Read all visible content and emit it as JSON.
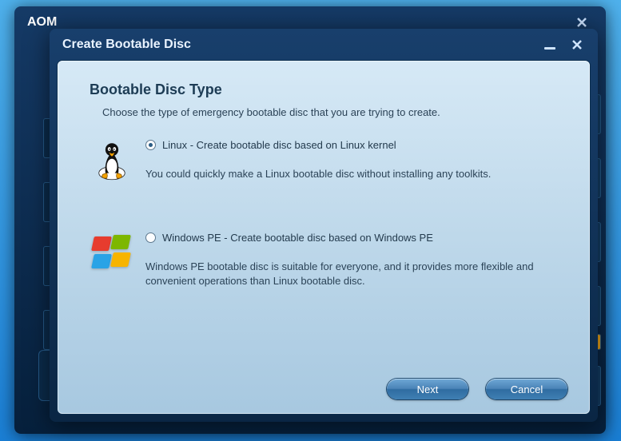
{
  "app": {
    "title_fragment": "AOM"
  },
  "dialog": {
    "title": "Create Bootable Disc",
    "heading": "Bootable Disc Type",
    "subtext": "Choose the type of emergency bootable disc that you are trying to create.",
    "options": [
      {
        "id": "linux",
        "label": "Linux - Create bootable disc based on Linux kernel",
        "description": "You could quickly make a Linux bootable disc without installing any toolkits.",
        "selected": true
      },
      {
        "id": "winpe",
        "label": "Windows PE - Create bootable disc based on Windows PE",
        "description": "Windows PE bootable disc is suitable for everyone, and it provides more flexible and convenient operations than Linux bootable disc.",
        "selected": false
      }
    ],
    "buttons": {
      "next": "Next",
      "cancel": "Cancel"
    }
  }
}
